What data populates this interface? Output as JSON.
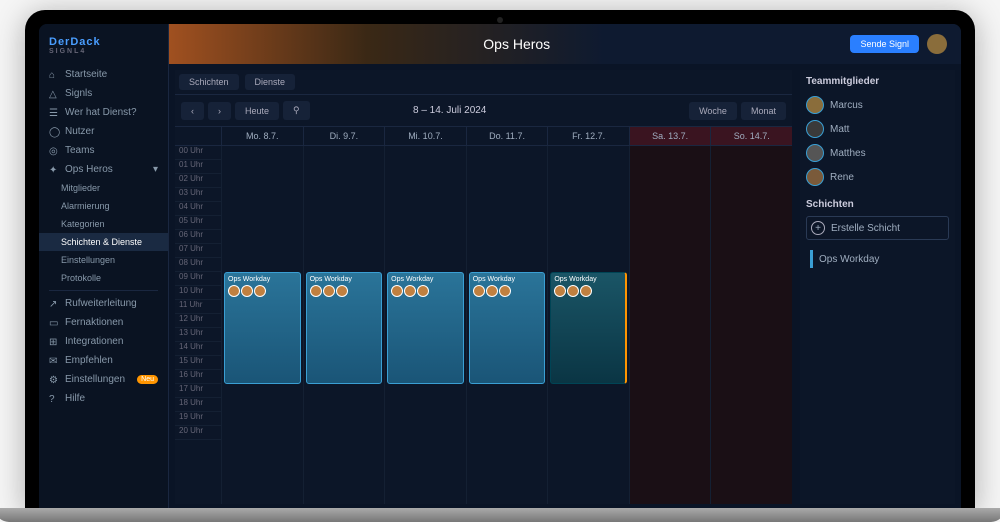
{
  "logo": {
    "brand": "DerDack",
    "product": "SIGNL4"
  },
  "header": {
    "title": "Ops Heros",
    "send_label": "Sende Signl"
  },
  "nav": {
    "items": [
      {
        "label": "Startseite"
      },
      {
        "label": "Signls"
      },
      {
        "label": "Wer hat Dienst?"
      },
      {
        "label": "Nutzer"
      },
      {
        "label": "Teams"
      }
    ],
    "team": {
      "label": "Ops Heros"
    },
    "team_sub": [
      {
        "label": "Mitglieder"
      },
      {
        "label": "Alarmierung"
      },
      {
        "label": "Kategorien"
      },
      {
        "label": "Schichten & Dienste"
      },
      {
        "label": "Einstellungen"
      },
      {
        "label": "Protokolle"
      }
    ],
    "bottom": [
      {
        "label": "Rufweiterleitung"
      },
      {
        "label": "Fernaktionen"
      },
      {
        "label": "Integrationen"
      },
      {
        "label": "Empfehlen"
      },
      {
        "label": "Einstellungen",
        "badge": "Neu"
      },
      {
        "label": "Hilfe"
      }
    ]
  },
  "tabs": {
    "schichten": "Schichten",
    "dienste": "Dienste"
  },
  "toolbar": {
    "heute": "Heute",
    "range": "8 – 14. Juli 2024",
    "woche": "Woche",
    "monat": "Monat"
  },
  "days": [
    "Mo. 8.7.",
    "Di. 9.7.",
    "Mi. 10.7.",
    "Do. 11.7.",
    "Fr. 12.7.",
    "Sa. 13.7.",
    "So. 14.7."
  ],
  "hours": [
    "00 Uhr",
    "01 Uhr",
    "02 Uhr",
    "03 Uhr",
    "04 Uhr",
    "05 Uhr",
    "06 Uhr",
    "07 Uhr",
    "08 Uhr",
    "09 Uhr",
    "10 Uhr",
    "11 Uhr",
    "12 Uhr",
    "13 Uhr",
    "14 Uhr",
    "15 Uhr",
    "16 Uhr",
    "17 Uhr",
    "18 Uhr",
    "19 Uhr",
    "20 Uhr"
  ],
  "shift_name": "Ops Workday",
  "panel": {
    "members_title": "Teammitglieder",
    "members": [
      "Marcus",
      "Matt",
      "Matthes",
      "Rene"
    ],
    "shifts_title": "Schichten",
    "create_label": "Erstelle Schicht",
    "shift_type": "Ops Workday"
  }
}
